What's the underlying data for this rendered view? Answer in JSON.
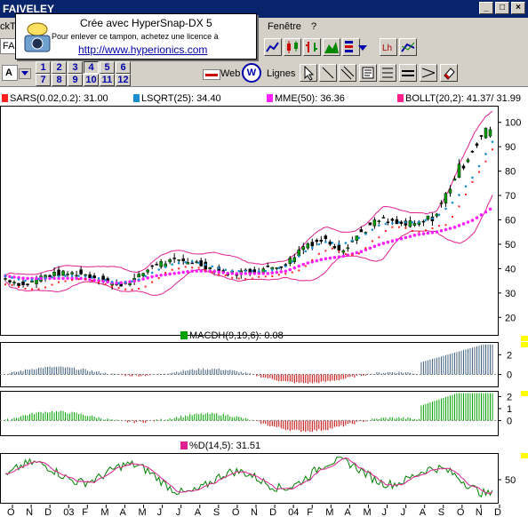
{
  "window": {
    "title": "FAIVELEY"
  },
  "menu": {
    "partial_left": "ckT",
    "fenetre": "Fenêtre",
    "help": "?"
  },
  "stamp": {
    "line1": "Crée avec HyperSnap-DX 5",
    "line2": "Pour enlever ce tampon, achetez une licence à",
    "line3": "http://www.hyperionics.com"
  },
  "toolbar": {
    "ticker_partial": "FA",
    "text_tool": "A",
    "period_buttons": [
      "1",
      "2",
      "3",
      "4",
      "5",
      "6",
      "7",
      "8",
      "9",
      "10",
      "11",
      "12"
    ],
    "web_label": "Web",
    "lines_label": "Lignes"
  },
  "colors": {
    "sars": "#ff2020",
    "lsqrt": "#1a8fd0",
    "mme": "#ff20ff",
    "bollt": "#ff2090",
    "candle_up": "#00a000",
    "candle_down": "#000000",
    "bollinger": "#e02090",
    "macd": "#00a000",
    "stoch_k": "#008000",
    "stoch_d": "#e02090",
    "yellow_marker": "#ffff00"
  },
  "legend": {
    "sars": "SARS(0.02,0.2): 31.00",
    "lsqrt": "LSQRT(25): 34.40",
    "mme": "MME(50): 36.36",
    "bollt": "BOLLT(20,2): 41.37/ 31.99"
  },
  "price_axis": [
    "100",
    "90",
    "80",
    "70",
    "60",
    "50",
    "40",
    "30",
    "20"
  ],
  "macd": {
    "label": "MACDH(9,19,6):  0.08",
    "axis": [
      "2",
      "0"
    ]
  },
  "macd2": {
    "axis": [
      "2",
      "1",
      "0"
    ]
  },
  "stoch": {
    "label": "%D(14,5): 31.51",
    "axis": [
      "50"
    ]
  },
  "x_axis": [
    "O",
    "N",
    "D",
    "03",
    "F",
    "M",
    "A",
    "M",
    "J",
    "J",
    "A",
    "S",
    "O",
    "N",
    "D",
    "04",
    "F",
    "M",
    "A",
    "M",
    "J",
    "J",
    "A",
    "S",
    "O",
    "N",
    "D"
  ],
  "chart_data": {
    "type": "line",
    "x": [
      "O",
      "N",
      "D",
      "03",
      "F",
      "M",
      "A",
      "M",
      "J",
      "J",
      "A",
      "S",
      "O",
      "N",
      "D",
      "04",
      "F",
      "M",
      "A",
      "M",
      "J",
      "J",
      "A",
      "S",
      "O",
      "N",
      "D"
    ],
    "ylim": [
      15,
      105
    ],
    "series": [
      {
        "name": "Close",
        "values": [
          36,
          33,
          37,
          38,
          38,
          36,
          33,
          36,
          42,
          43,
          43,
          40,
          38,
          39,
          40,
          42,
          50,
          52,
          48,
          55,
          60,
          58,
          58,
          62,
          78,
          90,
          99
        ]
      },
      {
        "name": "LSQRT(25)",
        "values": [
          37,
          35,
          36,
          37,
          37,
          36,
          34,
          35,
          39,
          42,
          43,
          41,
          39,
          39,
          39,
          41,
          47,
          51,
          50,
          53,
          58,
          59,
          59,
          61,
          68,
          78,
          92
        ]
      },
      {
        "name": "MME(50)",
        "values": [
          37,
          36,
          36,
          36,
          36,
          35,
          34,
          35,
          37,
          38,
          39,
          39,
          38,
          38,
          38,
          39,
          42,
          44,
          45,
          47,
          50,
          52,
          54,
          55,
          57,
          60,
          65
        ]
      }
    ]
  }
}
